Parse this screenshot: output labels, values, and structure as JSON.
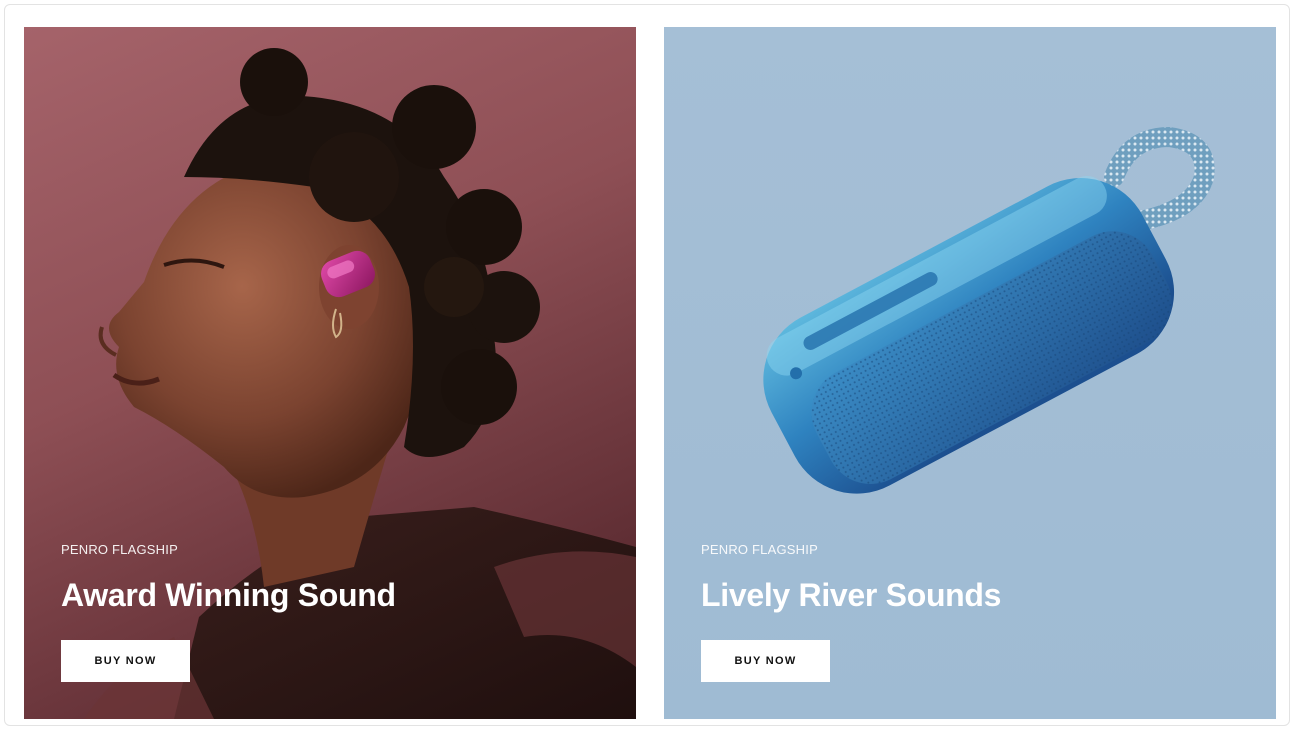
{
  "cards": [
    {
      "eyebrow": "PENRO FLAGSHIP",
      "title": "Award Winning Sound",
      "button_label": "BUY NOW",
      "background_color": "#8a4f4f",
      "image_subject": "woman-wearing-magenta-earbud"
    },
    {
      "eyebrow": "PENRO FLAGSHIP",
      "title": "Lively River Sounds",
      "button_label": "BUY NOW",
      "background_color": "#a3bdd4",
      "image_subject": "blue-bluetooth-speaker"
    }
  ],
  "colors": {
    "earbud_accent": "#b0207a",
    "speaker_accent": "#2f83c0",
    "button_bg": "#ffffff",
    "button_text": "#111111"
  }
}
